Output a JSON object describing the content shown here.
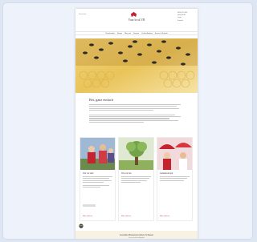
{
  "brand": {
    "name": "Your local VB",
    "accent": "#c4222e"
  },
  "header": {
    "top_left": "Startseite",
    "contact_lines": [
      "0800 123 456",
      "info@vb.de",
      "Login",
      "Kontakt"
    ]
  },
  "nav": {
    "items": [
      "Privatkunden",
      "Firmen",
      "Über uns",
      "Karriere",
      "Online-Banking",
      "Service & Kontakt"
    ]
  },
  "intro": {
    "title": "Bei, ganz einfach",
    "line_count": 10
  },
  "cards": [
    {
      "title": "Wer wir sind",
      "link": "Mehr erfahren"
    },
    {
      "title": "Was wir tun",
      "link": "Mehr erfahren"
    },
    {
      "title": "Gemeinsam gut",
      "link": "Mehr erfahren"
    }
  ],
  "footer": {
    "title": "Gesamte Bienenstockliste Schauen",
    "sub": "Ihr persönliches Angebot"
  }
}
